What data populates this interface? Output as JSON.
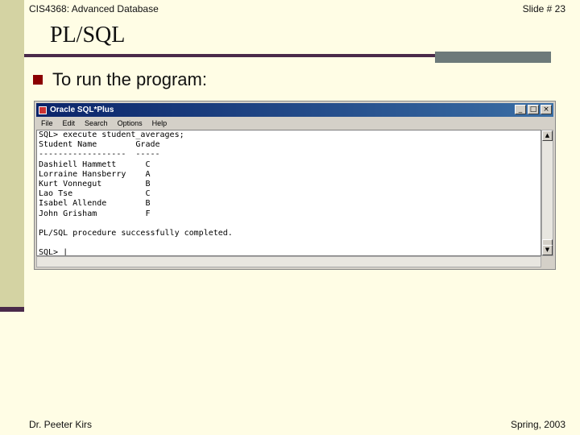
{
  "header": {
    "course": "CIS4368: Advanced Database",
    "slide_number": "Slide # 23"
  },
  "title": "PL/SQL",
  "bullet": {
    "text": "To run the program:"
  },
  "window": {
    "title": "Oracle SQL*Plus",
    "menu": [
      "File",
      "Edit",
      "Search",
      "Options",
      "Help"
    ],
    "console_lines": [
      "SQL> execute student_averages;",
      "Student Name        Grade",
      "------------------  -----",
      "Dashiell Hammett      C",
      "Lorraine Hansberry    A",
      "Kurt Vonnegut         B",
      "Lao Tse               C",
      "Isabel Allende        B",
      "John Grisham          F",
      "",
      "PL/SQL procedure successfully completed.",
      "",
      "SQL> |"
    ]
  },
  "footer": {
    "author": "Dr. Peeter Kirs",
    "term": "Spring, 2003"
  },
  "colors": {
    "background": "#fffde5",
    "left_band": "#d4d3a3",
    "accent": "#4a2a4a",
    "bullet": "#8b0000",
    "titlebar": "#0a246a"
  }
}
